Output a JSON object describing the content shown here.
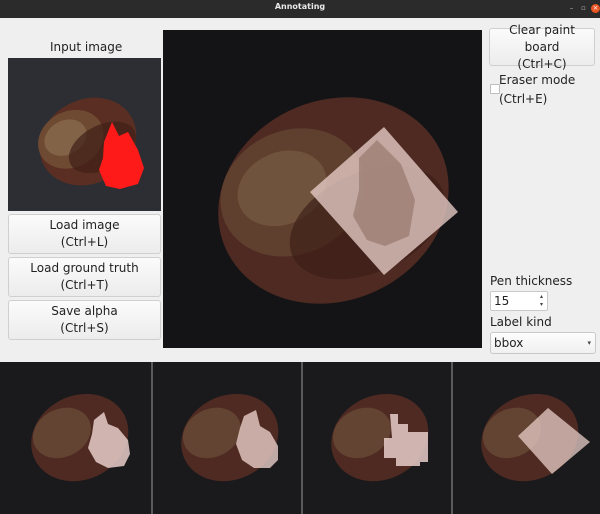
{
  "window": {
    "title": "Annotating",
    "controls": [
      "–",
      "▫",
      "×"
    ]
  },
  "left": {
    "input_label": "Input image",
    "load_image": [
      "Load image",
      "(Ctrl+L)"
    ],
    "load_gt": [
      "Load ground truth",
      "(Ctrl+T)"
    ],
    "save_alpha": [
      "Save alpha",
      "(Ctrl+S)"
    ]
  },
  "right": {
    "clear_board": [
      "Clear paint board",
      "(Ctrl+C)"
    ],
    "eraser": [
      "Eraser mode",
      "(Ctrl+E)"
    ],
    "eraser_checked": false,
    "pen_label": "Pen thickness",
    "pen_value": "15",
    "label_kind_label": "Label kind",
    "label_kind_value": "bbox"
  },
  "colors": {
    "mask_red": "#ff1a1a",
    "overlay_pink": "#e8cdc8",
    "panel_bg": "#141416",
    "accent_close": "#e95420"
  }
}
